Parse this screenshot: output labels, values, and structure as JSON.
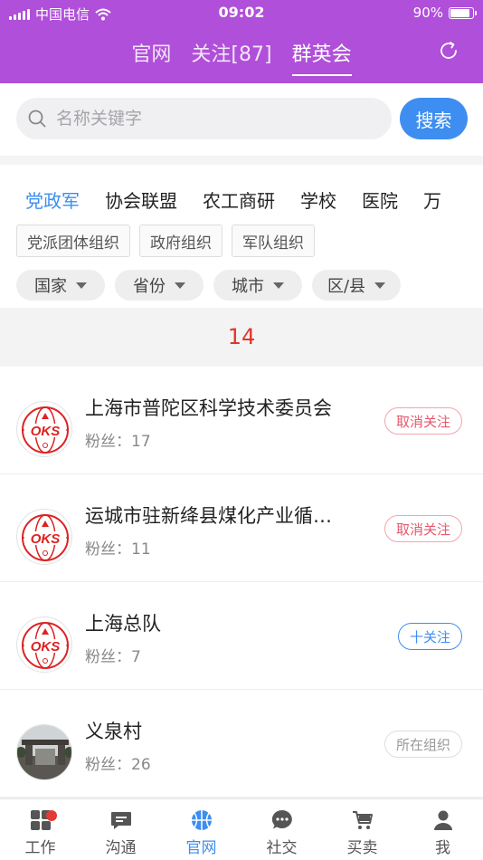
{
  "status": {
    "carrier": "中国电信",
    "time": "09:02",
    "battery": "90%",
    "battery_level": 0.9
  },
  "top_tabs": [
    {
      "label": "官网",
      "active": false
    },
    {
      "label": "关注[87]",
      "active": false
    },
    {
      "label": "群英会",
      "active": true
    }
  ],
  "search": {
    "placeholder": "名称关键字",
    "value": "",
    "button_label": "搜索"
  },
  "categories": [
    {
      "label": "党政军",
      "active": true
    },
    {
      "label": "协会联盟",
      "active": false
    },
    {
      "label": "农工商研",
      "active": false
    },
    {
      "label": "学校",
      "active": false
    },
    {
      "label": "医院",
      "active": false
    },
    {
      "label": "万",
      "active": false
    }
  ],
  "subcategories": [
    "党派团体组织",
    "政府组织",
    "军队组织"
  ],
  "dropdowns": [
    "国家",
    "省份",
    "城市",
    "区/县"
  ],
  "result_count": "14",
  "fans_prefix": "粉丝：",
  "items": [
    {
      "title": "上海市普陀区科学技术委员会",
      "fans": "17",
      "action": "取消关注",
      "action_type": "unfollow",
      "avatar": "oks-logo",
      "avatar_text": "OKS"
    },
    {
      "title": "运城市驻新绛县煤化产业循…",
      "fans": "11",
      "action": "取消关注",
      "action_type": "unfollow",
      "avatar": "oks-logo",
      "avatar_text": "OKS"
    },
    {
      "title": "上海总队",
      "fans": "7",
      "action": "十关注",
      "action_type": "follow",
      "avatar": "oks-logo",
      "avatar_text": "OKS"
    },
    {
      "title": "义泉村",
      "fans": "26",
      "action": "所在组织",
      "action_type": "org",
      "avatar": "village-gate-photo"
    }
  ],
  "tabbar": [
    {
      "label": "工作",
      "icon": "grid-icon",
      "active": false,
      "badge": true
    },
    {
      "label": "沟通",
      "icon": "chat-icon",
      "active": false
    },
    {
      "label": "官网",
      "icon": "basketball-icon",
      "active": true
    },
    {
      "label": "社交",
      "icon": "bubble-icon",
      "active": false
    },
    {
      "label": "买卖",
      "icon": "cart-icon",
      "active": false
    },
    {
      "label": "我",
      "icon": "user-icon",
      "active": false
    }
  ],
  "colors": {
    "header": "#b04fd9",
    "accent": "#3d8ef0",
    "count": "#e0362c",
    "unfollow": "#e4586c"
  }
}
